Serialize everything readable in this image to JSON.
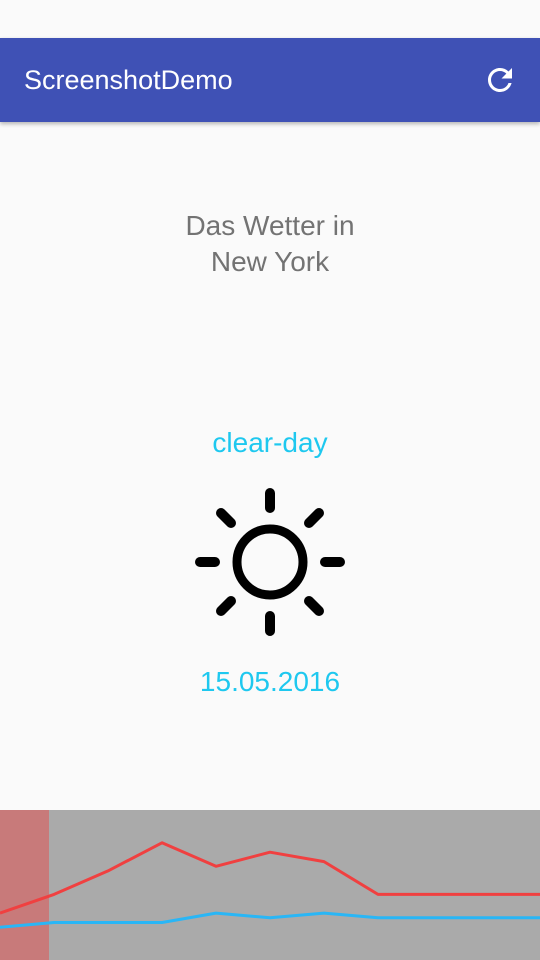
{
  "app": {
    "title": "ScreenshotDemo",
    "refresh_icon": "refresh-icon",
    "accent_color": "#3f51b5"
  },
  "main": {
    "city_line1": "Das Wetter in",
    "city_line2": "New York",
    "condition": "clear-day",
    "condition_icon": "sun-icon",
    "date": "15.05.2016",
    "text_color": "#1ec8ef"
  },
  "chart_data": {
    "type": "line",
    "x": [
      0,
      1,
      2,
      3,
      4,
      5,
      6,
      7,
      8,
      9,
      10
    ],
    "series": [
      {
        "color": "#f04040",
        "values": [
          20,
          24,
          29,
          35,
          30,
          33,
          31,
          24,
          24,
          24,
          24
        ]
      },
      {
        "color": "#29b6f6",
        "values": [
          17,
          18,
          18,
          18,
          20,
          19,
          20,
          19,
          19,
          19,
          19
        ]
      }
    ],
    "ylim": [
      10,
      42
    ],
    "highlight_index": 0,
    "highlight_color": "#c87a7a",
    "background": "#aaaaaa"
  }
}
